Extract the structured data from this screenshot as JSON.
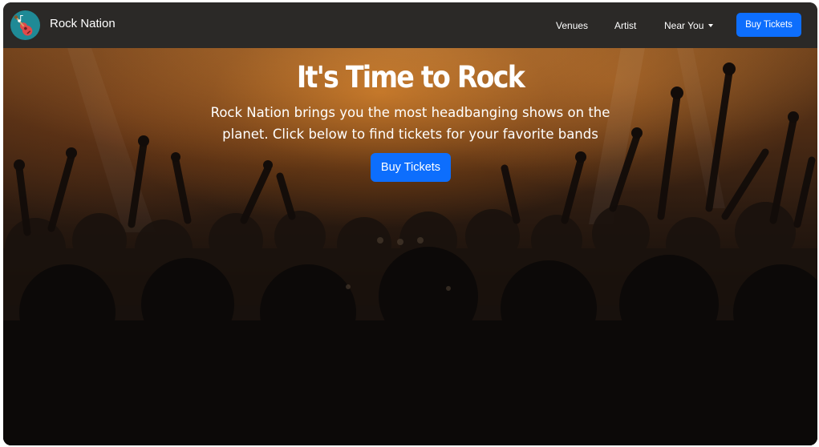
{
  "navbar": {
    "brand": "Rock Nation",
    "logo_icon": "guitar-icon",
    "links": [
      {
        "label": "Venues"
      },
      {
        "label": "Artist"
      },
      {
        "label": "Near You",
        "icon": "caret-down-icon"
      }
    ],
    "cta_label": "Buy Tickets"
  },
  "hero": {
    "title": "It's Time to Rock",
    "description": "Rock Nation brings you the most headbanging shows on the planet. Click below to find tickets for your favorite bands",
    "button_label": "Buy Tickets",
    "background": "concert-crowd-photo"
  },
  "colors": {
    "navbar_bg": "#2b2927",
    "primary_button": "#0d6efd",
    "logo_bg": "#1f8a96",
    "text": "#ffffff"
  }
}
